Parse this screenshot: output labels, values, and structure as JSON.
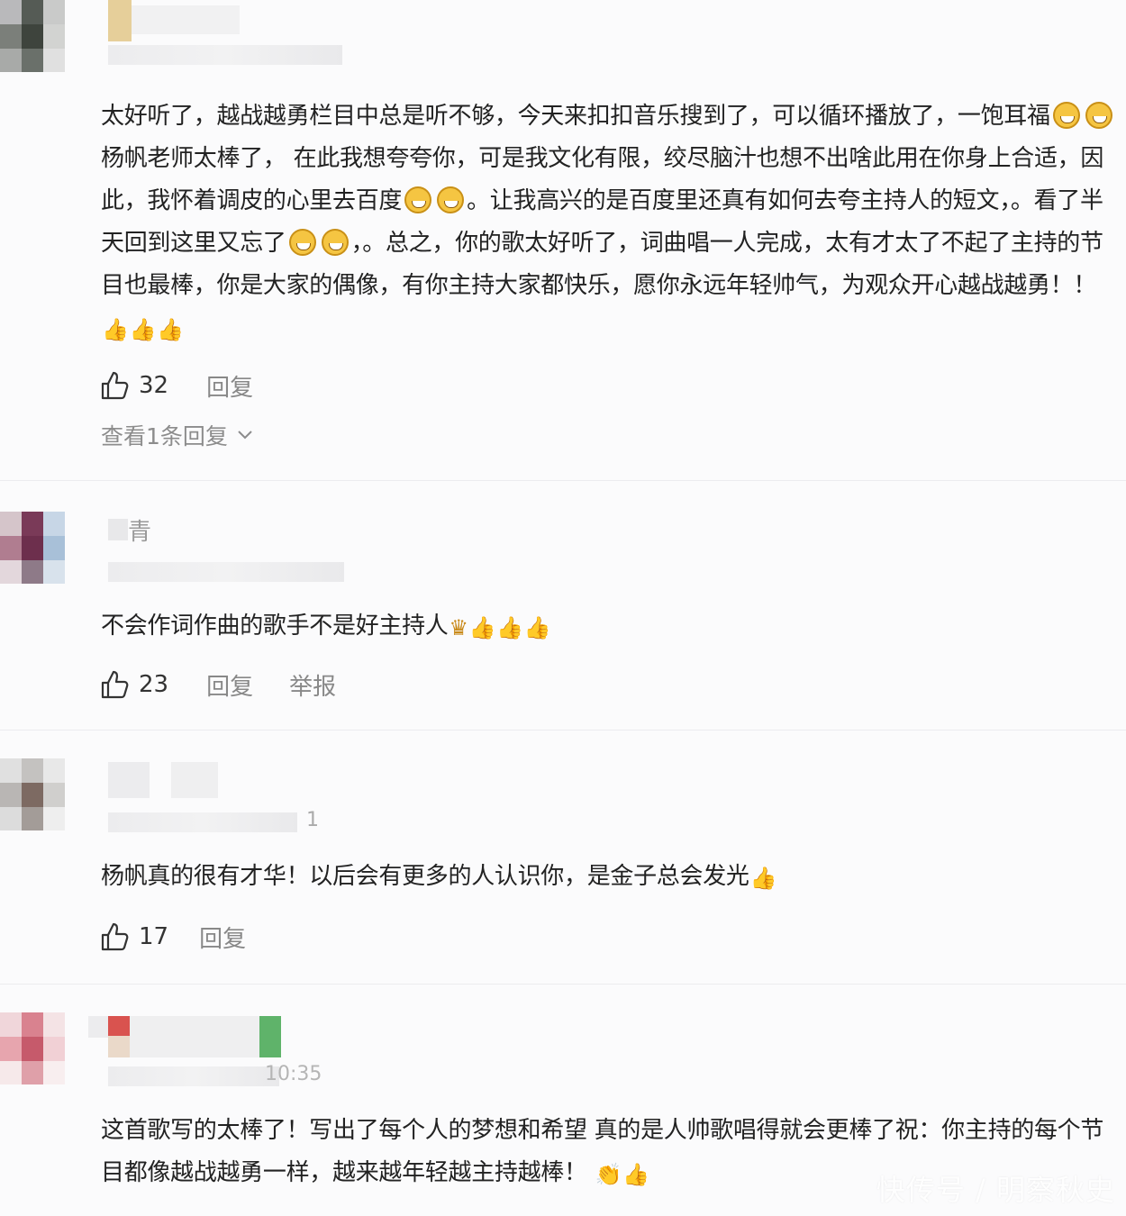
{
  "comments": [
    {
      "text_parts": [
        "太好听了，越战越勇栏目中总是听不够，今天来扣扣音乐搜到了，可以循环播放了，一饱耳福",
        "杨帆老师太棒了， 在此我想夸夸你，可是我文化有限，绞尽脑汁也想不出啥此用在你身上合适，因此，我怀着调皮的心里去百度",
        "。让我高兴的是百度里还真有如何去夸主持人的短文，。看了半天回到这里又忘了",
        "，。总之，你的歌太好听了，词曲唱一人完成，太有才太了不起了主持的节目也最棒，你是大家的偶像，有你主持大家都快乐，愿你永远年轻帅气，为观众开心越战越勇！！"
      ],
      "likes": "32",
      "reply_label": "回复",
      "view_replies": "查看1条回复"
    },
    {
      "name_fragment": "青",
      "text": "不会作词作曲的歌手不是好主持人",
      "likes": "23",
      "reply_label": "回复",
      "report_label": "举报"
    },
    {
      "time_fragment": "1",
      "text": "杨帆真的很有才华！以后会有更多的人认识你，是金子总会发光",
      "likes": "17",
      "reply_label": "回复"
    },
    {
      "time_fragment": "10:35",
      "text": "这首歌写的太棒了！写出了每个人的梦想和希望 真的是人帅歌唱得就会更棒了祝：你主持的每个节目都像越战越勇一样，越来越年轻越主持越棒！"
    }
  ],
  "icons": {
    "like": "thumbs-up-outline-icon",
    "emoji_grin": "grinning-face-emoji",
    "emoji_thumb": "thumbs-up-emoji",
    "emoji_clap": "clapping-hands-emoji",
    "emoji_sparkle_person": "person-emoji",
    "chevron": "chevron-down-icon"
  },
  "watermark": "快传号 / 明察秋史",
  "colors": {
    "background": "#fbfbfc",
    "text": "#222222",
    "muted": "#888888",
    "emoji_yellow": "#f5c542"
  }
}
